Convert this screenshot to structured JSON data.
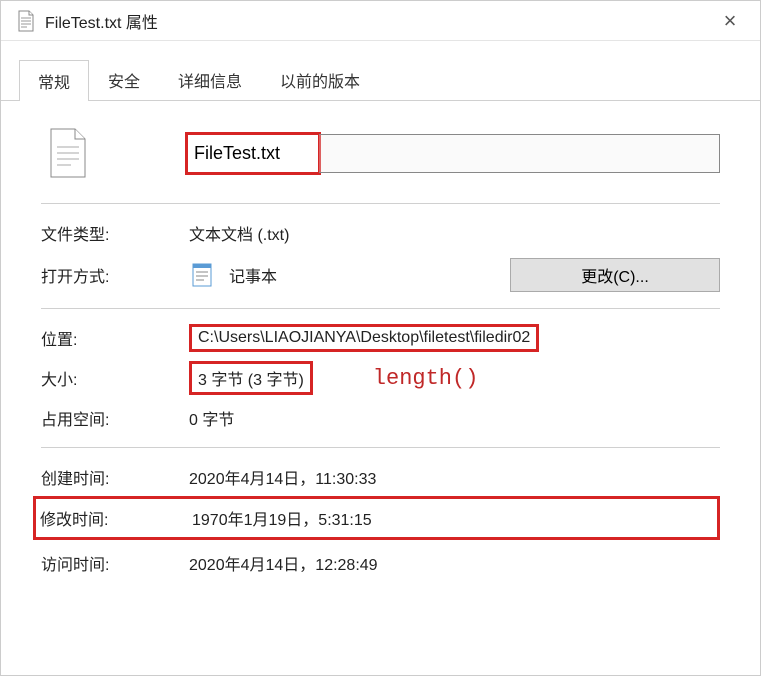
{
  "titlebar": {
    "title": "FileTest.txt 属性"
  },
  "tabs": {
    "general": "常规",
    "security": "安全",
    "details": "详细信息",
    "previous": "以前的版本"
  },
  "file": {
    "name": "FileTest.txt"
  },
  "rows": {
    "type_label": "文件类型:",
    "type_value": "文本文档 (.txt)",
    "openwith_label": "打开方式:",
    "openwith_value": "记事本",
    "change_btn": "更改(C)...",
    "location_label": "位置:",
    "location_value": "C:\\Users\\LIAOJIANYA\\Desktop\\filetest\\filedir02",
    "size_label": "大小:",
    "size_value": "3 字节 (3 字节)",
    "sizeondisk_label": "占用空间:",
    "sizeondisk_value": "0 字节",
    "created_label": "创建时间:",
    "created_value": "2020年4月14日，11:30:33",
    "modified_label": "修改时间:",
    "modified_value": "1970年1月19日，5:31:15",
    "accessed_label": "访问时间:",
    "accessed_value": "2020年4月14日，12:28:49"
  },
  "annotation": {
    "length": "length()"
  }
}
